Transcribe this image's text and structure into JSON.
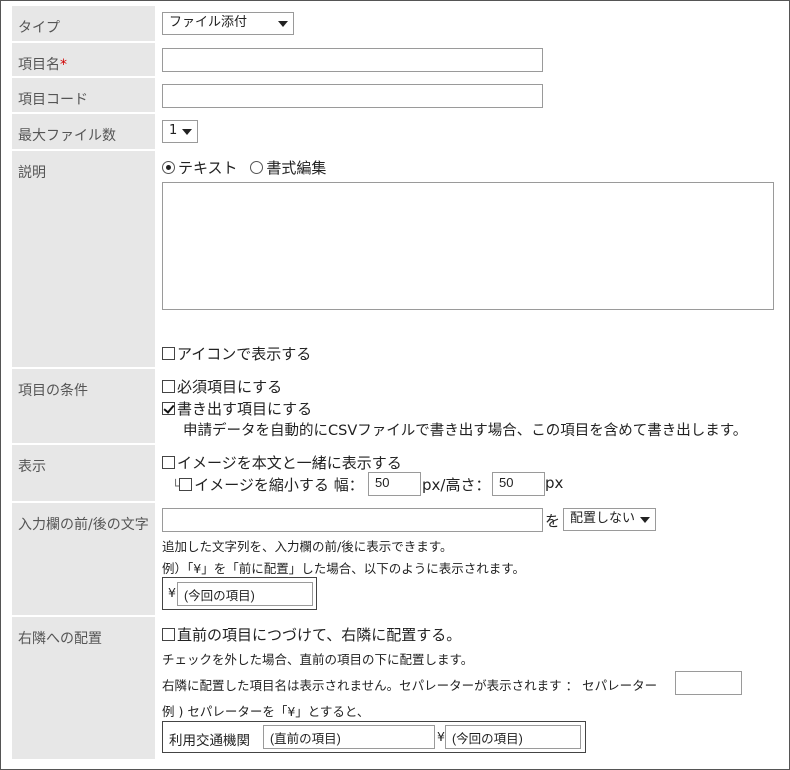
{
  "labels": {
    "type": "タイプ",
    "item_name": "項目名",
    "item_name_required": "*",
    "item_code": "項目コード",
    "max_files": "最大ファイル数",
    "description": "説明",
    "conditions": "項目の条件",
    "display": "表示",
    "before_after_text": "入力欄の前/後の文字",
    "right_placement": "右隣への配置"
  },
  "type_select": {
    "value": "ファイル添付"
  },
  "item_name_input": {
    "value": ""
  },
  "item_code_input": {
    "value": ""
  },
  "max_files_select": {
    "value": "1"
  },
  "description": {
    "radio_text": "テキスト",
    "radio_rich": "書式編集",
    "selected": "テキスト",
    "textarea_value": "",
    "show_icon_label": "アイコンで表示する",
    "show_icon_checked": false
  },
  "conditions": {
    "required_label": "必須項目にする",
    "required_checked": false,
    "export_label": "書き出す項目にする",
    "export_checked": true,
    "export_note": "申請データを自動的にCSVファイルで書き出す場合、この項目を含めて書き出します。"
  },
  "display": {
    "inline_image_label": "イメージを本文と一緒に表示する",
    "inline_image_checked": false,
    "tree_prefix": "└",
    "shrink_label": "イメージを縮小する",
    "shrink_checked": false,
    "width_label": "幅：",
    "width_value": "50",
    "px_height_label": "px/高さ：",
    "height_value": "50",
    "px_label": "px"
  },
  "before_after": {
    "text_value": "",
    "wo_label": "を",
    "placement_value": "配置しない",
    "note1": "追加した文字列を、入力欄の前/後に表示できます。",
    "note2": "例）「¥」を「前に配置」した場合、以下のように表示されます。",
    "example_prefix": "¥",
    "example_value": "(今回の項目)"
  },
  "right_placement": {
    "checkbox_label": "直前の項目につづけて、右隣に配置する。",
    "checked": false,
    "note1": "チェックを外した場合、直前の項目の下に配置します。",
    "note2": "右隣に配置した項目名は表示されません。セパレーターが表示されます ： セパレーター",
    "separator_value": "",
    "note3": "例 ) セパレーターを「¥」とすると、",
    "example_label": "利用交通機関",
    "example_prev_value": "(直前の項目)",
    "example_sep": "¥",
    "example_current_value": "(今回の項目)"
  }
}
